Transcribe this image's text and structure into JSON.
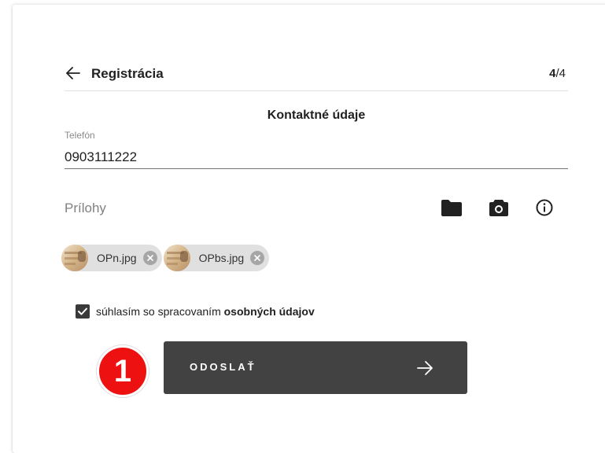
{
  "header": {
    "title": "Registrácia",
    "step_current": "4",
    "step_total": "/4",
    "back_icon": "arrow-left-icon"
  },
  "section": {
    "title": "Kontaktné údaje"
  },
  "phone": {
    "label": "Telefón",
    "value": "0903111222"
  },
  "attachments": {
    "label": "Prílohy",
    "icons": [
      "folder-icon",
      "camera-icon",
      "info-icon"
    ],
    "files": [
      {
        "name": "OPn.jpg"
      },
      {
        "name": "OPbs.jpg"
      }
    ]
  },
  "consent": {
    "checked": true,
    "text_plain": "súhlasím so spracovaním ",
    "text_bold": "osobných údajov"
  },
  "badge": {
    "number": "1",
    "color": "#ee1111"
  },
  "submit": {
    "label": "ODOSLAŤ",
    "background": "#424242"
  }
}
